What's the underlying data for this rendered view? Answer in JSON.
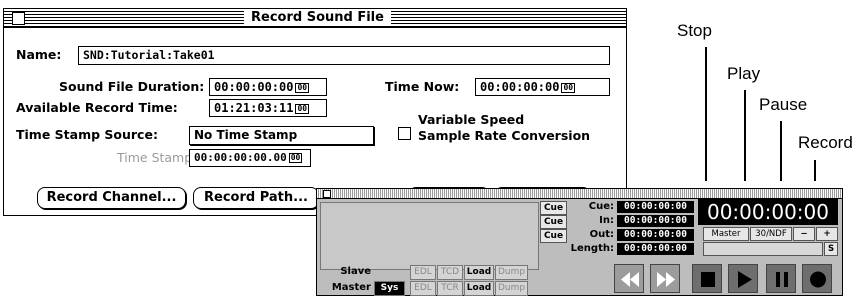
{
  "record_window": {
    "title": "Record Sound File",
    "name_label": "Name:",
    "name_value": "SND:Tutorial:Take01",
    "duration_label": "Sound File Duration:",
    "duration_value": "00:00:00:00",
    "available_label": "Available Record Time:",
    "available_value": "01:21:03:11",
    "source_label": "Time Stamp Source:",
    "source_value": "No Time Stamp",
    "stamp_label": "Time Stamp:",
    "stamp_value": "00:00:00:00.00",
    "time_now_label": "Time Now:",
    "time_now_value": "00:00:00:00",
    "variable_speed_label": "Variable Speed",
    "sample_rate_label": "Sample Rate Conversion",
    "record_channel_btn": "Record Channel...",
    "record_path_btn": "Record Path...",
    "tc_suffix": "00"
  },
  "transport": {
    "cue_btn": "Cue",
    "cue_label": "Cue:",
    "in_label": "In:",
    "out_label": "Out:",
    "length_label": "Length:",
    "cue_value": "00:00:00:00",
    "in_value": "00:00:00:00",
    "out_value": "00:00:00:00",
    "length_value": "00:00:00:00",
    "big_timecode": "00:00:00:00",
    "master_btn": "Master",
    "fps_btn": "30/NDF",
    "minus_btn": "−",
    "plus_btn": "+",
    "s_btn": "S",
    "slave_label": "Slave",
    "master_label": "Master",
    "sys_btn": "Sys",
    "edl_btn": "EDL",
    "tcd_btn": "TCD",
    "tcr_btn": "TCR",
    "load_btn": "Load",
    "dump_btn": "Dump"
  },
  "annotations": {
    "stop": "Stop",
    "play": "Play",
    "pause": "Pause",
    "record": "Record"
  },
  "icons": [
    "close-box-icon",
    "rewind-icon",
    "fast-forward-icon",
    "stop-icon",
    "play-icon",
    "pause-icon",
    "record-icon"
  ]
}
